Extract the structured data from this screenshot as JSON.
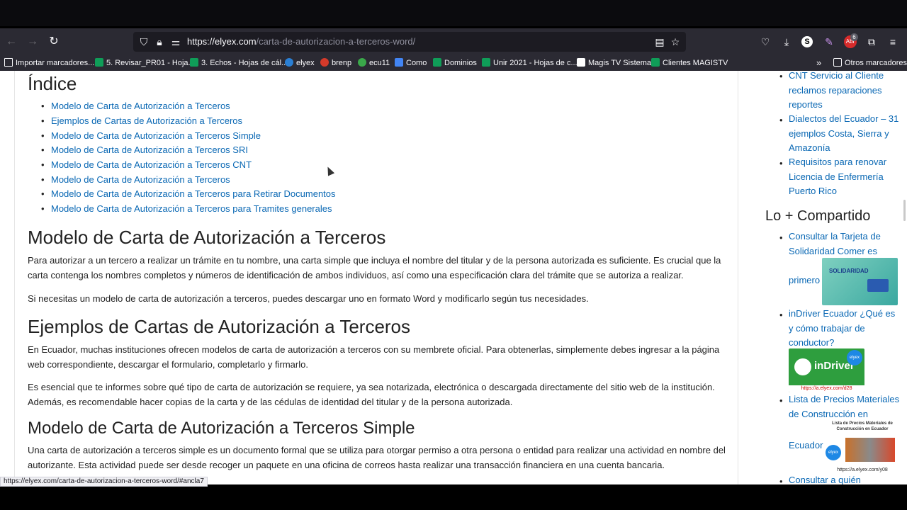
{
  "browser": {
    "url_host": "https://elyex.com",
    "url_path": "/carta-de-autorizacion-a-terceros-word/",
    "badge_count": "6",
    "abp_label": "Abr"
  },
  "bookmarks": [
    {
      "label": "Importar marcadores...",
      "icon": "import-icon"
    },
    {
      "label": "5. Revisar_PR01 - Hoja...",
      "icon": "sheets-icon"
    },
    {
      "label": "3. Echos - Hojas de cál...",
      "icon": "sheets-icon"
    },
    {
      "label": "elyex",
      "icon": "globe-icon"
    },
    {
      "label": "brenp",
      "icon": "globe-icon"
    },
    {
      "label": "ecu11",
      "icon": "globe-icon"
    },
    {
      "label": "Como",
      "icon": "docs-icon"
    },
    {
      "label": "Dominios",
      "icon": "sheets-icon"
    },
    {
      "label": "Unir 2021 - Hojas de c...",
      "icon": "sheets-icon"
    },
    {
      "label": "Magis TV Sistema",
      "icon": "page-icon"
    },
    {
      "label": "Clientes MAGISTV",
      "icon": "sheets-icon"
    },
    {
      "label": "Otros marcadores",
      "icon": "folder-icon"
    }
  ],
  "article": {
    "index_title": "Índice",
    "toc": [
      "Modelo de Carta de Autorización a Terceros",
      "Ejemplos de Cartas de Autorización a Terceros",
      "Modelo de Carta de Autorización a Terceros Simple",
      "Modelo de Carta de Autorización a Terceros SRI",
      "Modelo de Carta de Autorización a Terceros CNT",
      "Modelo de Carta de Autorización a Terceros",
      "Modelo de Carta de Autorización a Terceros para Retirar Documentos",
      "Modelo de Carta de Autorización a Terceros para Tramites generales"
    ],
    "h_modelo": "Modelo de Carta de Autorización a Terceros",
    "p1": "Para autorizar a un tercero a realizar un trámite en tu nombre, una carta simple que incluya el nombre del titular y de la persona autorizada es suficiente. Es crucial que la carta contenga los nombres completos y números de identificación de ambos individuos, así como una especificación clara del trámite que se autoriza a realizar.",
    "p2": "Si necesitas un modelo de carta de autorización a terceros, puedes descargar uno en formato Word y modificarlo según tus necesidades.",
    "h_ejemplos": "Ejemplos de Cartas de Autorización a Terceros",
    "p3": "En Ecuador, muchas instituciones ofrecen modelos de carta de autorización a terceros con su membrete oficial. Para obtenerlas, simplemente debes ingresar a la página web correspondiente, descargar el formulario, completarlo y firmarlo.",
    "p4": "Es esencial que te informes sobre qué tipo de carta de autorización se requiere, ya sea notarizada, electrónica o descargada directamente del sitio web de la institución. Además, es recomendable hacer copias de la carta y de las cédulas de identidad del titular y de la persona autorizada.",
    "h_simple": "Modelo de Carta de Autorización a Terceros Simple",
    "p5": "Una carta de autorización a terceros simple es un documento formal que se utiliza para otorgar permiso a otra persona o entidad para realizar una actividad en nombre del autorizante. Esta actividad puede ser desde recoger un paquete en una oficina de correos hasta realizar una transacción financiera en una cuenta bancaria."
  },
  "sidebar": {
    "links_top": [
      "CNT Servicio al Cliente reclamos reparaciones reportes",
      "Dialectos del Ecuador – 31 ejemplos Costa, Sierra y Amazonía",
      "Requisitos para renovar Licencia de Enfermería Puerto Rico"
    ],
    "heading": "Lo + Compartido",
    "shared": [
      {
        "text": "Consultar la Tarjeta de Solidaridad Comer es",
        "tail": "primero"
      },
      {
        "text": "inDriver Ecuador ¿Qué es y cómo trabajar de conductor?",
        "tail": ""
      },
      {
        "text": "Lista de Precios Materiales de Construcción en",
        "tail": "Ecuador"
      },
      {
        "text": "Consultar a quién",
        "tail": ""
      }
    ],
    "thumb_solidaridad": {
      "brand": "SOLIDARIDAD"
    },
    "thumb_indriver": {
      "brand": "inDriver",
      "url": "https://a.elyex.com/d28",
      "badge": "elyex"
    },
    "thumb_precios": {
      "title": "Lista de Precios Materiales de Construcción en Ecuador",
      "url": "https://a.elyex.com/y08",
      "badge": "elyex"
    }
  },
  "status_url": "https://elyex.com/carta-de-autorizacion-a-terceros-word/#ancla7"
}
